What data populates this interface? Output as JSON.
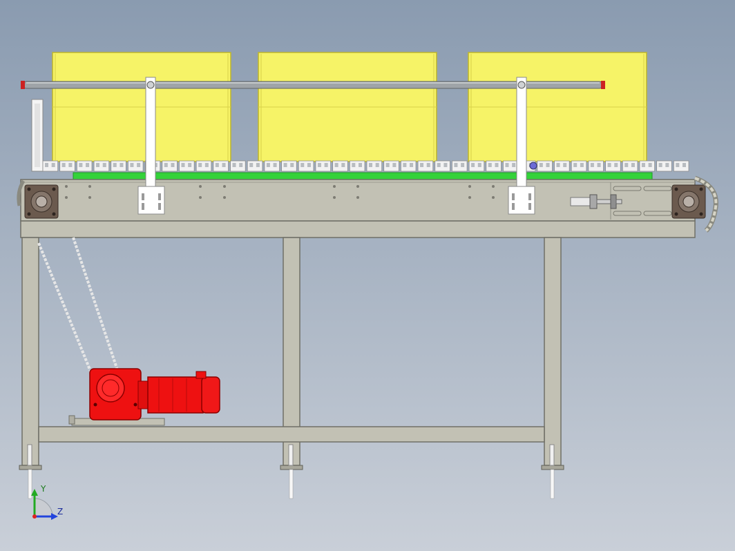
{
  "view": {
    "background_top": "#8a9bb0",
    "background_bottom": "#c9cfd8"
  },
  "model": {
    "frame_color": "#c2c1b4",
    "frame_edge": "#6f6f66",
    "box_color": "#f6f367",
    "box_edge": "#bdb52c",
    "guide_rail_color": "#9fa4a8",
    "rail_end_color": "#cc2222",
    "wear_strip_color": "#34d23a",
    "motor_color": "#ee1111",
    "bracket_color": "#ffffff",
    "chain_link_count": 38,
    "box_count": 3,
    "leg_count": 3
  },
  "triad": {
    "y_label": "Y",
    "z_label": "Z",
    "y_color": "#22aa22",
    "z_color": "#2244dd",
    "origin_color": "#dd2222"
  }
}
